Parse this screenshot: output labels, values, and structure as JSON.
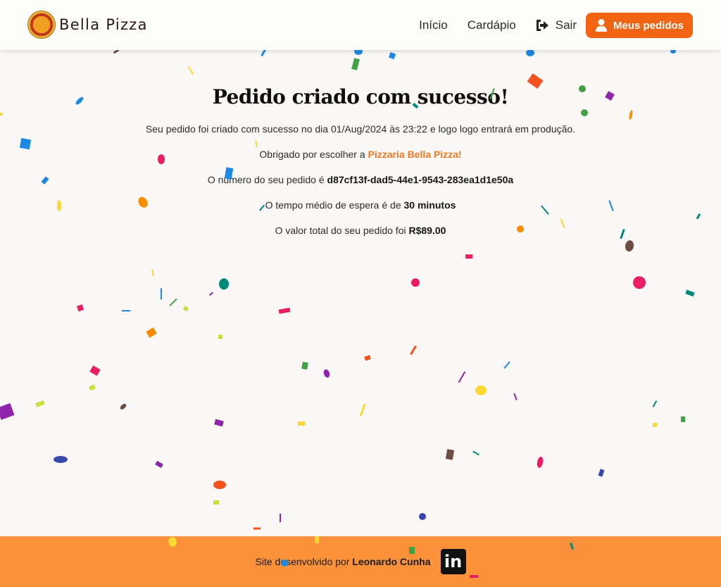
{
  "header": {
    "brand": "Bella Pizza",
    "nav": {
      "home": "Início",
      "menu": "Cardápio",
      "logout": "Sair",
      "orders": "Meus pedidos"
    },
    "icons": {
      "logout": "sign-out-icon",
      "orders": "user-icon",
      "logo": "pizza-logo"
    },
    "accent_color": "#f06414"
  },
  "main": {
    "title": "Pedido criado com sucesso!",
    "created_prefix": "Seu pedido foi criado com sucesso no dia ",
    "created_date": "01/Aug/2024 às 23:22",
    "created_suffix": " e logo logo entrará em produção.",
    "thanks_prefix": "Obrigado por escolher a ",
    "thanks_brand": "Pizzaria Bella Pizza!",
    "order_prefix": "O número do seu pedido é ",
    "order_id": "d87cf13f-dad5-44e1-9543-283ea1d1e50a",
    "wait_prefix": "O tempo médio de espera é de ",
    "wait_time": "30 minutos",
    "total_prefix": "O valor total do seu pedido foi ",
    "total_value": "R$89.00"
  },
  "footer": {
    "credit_prefix": "Site desenvolvido por ",
    "author": "Leonardo Cunha",
    "linkedin_glyph": "in",
    "background": "#fb913a"
  },
  "confetti_colors": [
    "#f4511e",
    "#1e88e5",
    "#43a047",
    "#fdd835",
    "#e91e63",
    "#8e24aa",
    "#00897b",
    "#fb8c00",
    "#3949ab",
    "#6d4c41",
    "#cddc39",
    "#039be5"
  ]
}
